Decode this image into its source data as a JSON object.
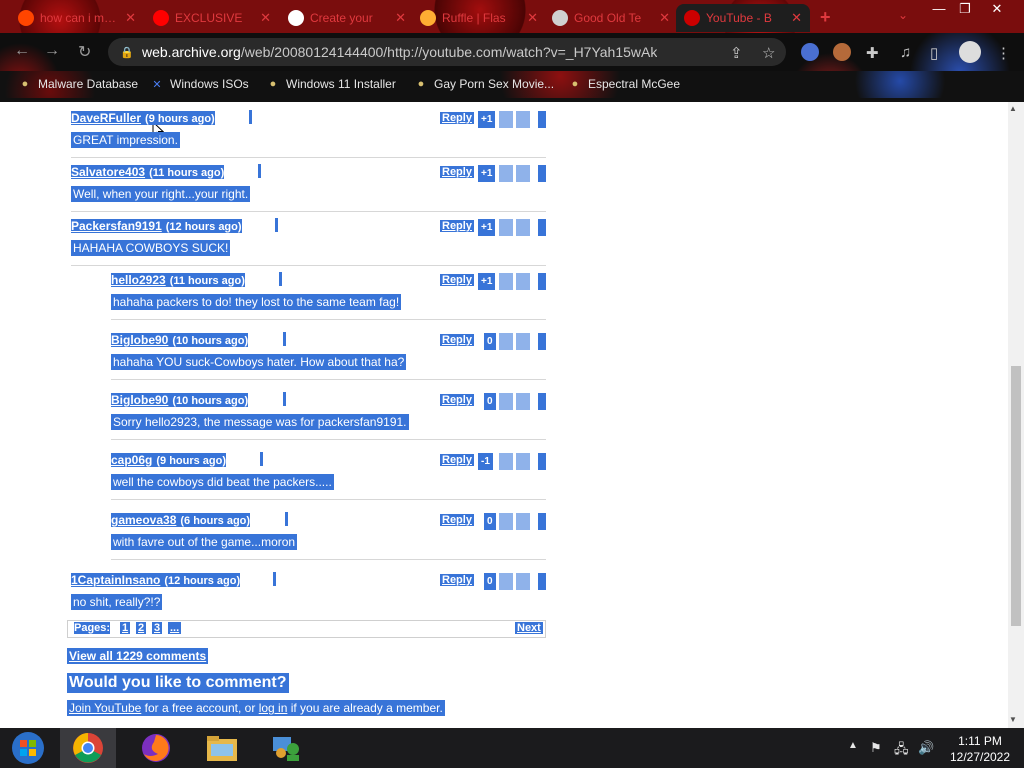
{
  "tabs": [
    {
      "title": "how can i make",
      "icon": "reddit-icon",
      "icon_color": "#ff4500"
    },
    {
      "title": "EXCLUSIVE",
      "icon": "youtube-icon",
      "icon_color": "#ff0000"
    },
    {
      "title": "Create your",
      "icon": "google-icon",
      "icon_color": "#ffffff"
    },
    {
      "title": "Ruffle | Flas",
      "icon": "ruffle-icon",
      "icon_color": "#ffad33"
    },
    {
      "title": "Good Old Te",
      "icon": "page-icon",
      "icon_color": "#d0d0d0"
    },
    {
      "title": "YouTube - B",
      "icon": "youtube-old-icon",
      "icon_color": "#cc0000"
    }
  ],
  "window": {
    "minimize": "—",
    "restore": "❐",
    "close": "✕"
  },
  "address": {
    "domain": "web.archive.org",
    "path": "/web/20080124144400/http://youtube.com/watch?v=_H7Yah15wAk"
  },
  "bookmarks": [
    {
      "label": "Malware Database",
      "icon": "bug-icon"
    },
    {
      "label": "Windows ISOs",
      "icon": "x-icon"
    },
    {
      "label": "Windows 11 Installer",
      "icon": "installer-icon"
    },
    {
      "label": "Gay Porn Sex Movie...",
      "icon": "site-icon"
    },
    {
      "label": "Espectral McGee",
      "icon": "site-icon"
    }
  ],
  "comments": [
    {
      "user": "DaveRFuller",
      "time": "(9 hours ago)",
      "text": "GREAT impression.",
      "rating": "+1",
      "indent": false
    },
    {
      "user": "Salvatore403",
      "time": "(11 hours ago)",
      "text": "Well, when your right...your right.",
      "rating": "+1",
      "indent": false
    },
    {
      "user": "Packersfan9191",
      "time": "(12 hours ago)",
      "text": "HAHAHA COWBOYS SUCK!",
      "rating": "+1",
      "indent": false
    },
    {
      "user": "hello2923",
      "time": "(11 hours ago)",
      "text": "hahaha packers to do! they lost to the same team fag!",
      "rating": "+1",
      "indent": true
    },
    {
      "user": "Biglobe90",
      "time": "(10 hours ago)",
      "text": "hahaha YOU suck-Cowboys hater. How about that ha?",
      "rating": "0",
      "indent": true
    },
    {
      "user": "Biglobe90",
      "time": "(10 hours ago)",
      "text": "Sorry hello2923, the message was for packersfan9191.",
      "rating": "0",
      "indent": true
    },
    {
      "user": "cap06g",
      "time": "(9 hours ago)",
      "text": "well the cowboys did beat the packers.....",
      "rating": "-1",
      "indent": true
    },
    {
      "user": "gameova38",
      "time": "(6 hours ago)",
      "text": "with favre out of the game...moron",
      "rating": "0",
      "indent": true
    },
    {
      "user": "1CaptainInsano",
      "time": "(12 hours ago)",
      "text": "no shit, really?!?",
      "rating": "0",
      "indent": false
    }
  ],
  "reply_label": "Reply",
  "pagination": {
    "label": "Pages:",
    "pages": [
      "1",
      "2",
      "3",
      "..."
    ],
    "next": "Next"
  },
  "view_all": "View all 1229 comments",
  "comment_heading": "Would you like to comment?",
  "join": {
    "link1": "Join YouTube",
    "mid": " for a free account, or ",
    "link2": "log in",
    "tail": " if you are already a member."
  },
  "taskbar": [
    "windows-start-icon",
    "chrome-icon",
    "firefox-icon",
    "file-explorer-icon",
    "network-users-icon"
  ],
  "clock": {
    "time": "1:11 PM",
    "date": "12/27/2022"
  },
  "colors": {
    "selection": "#3874d8",
    "tab_text": "#e0393e"
  }
}
